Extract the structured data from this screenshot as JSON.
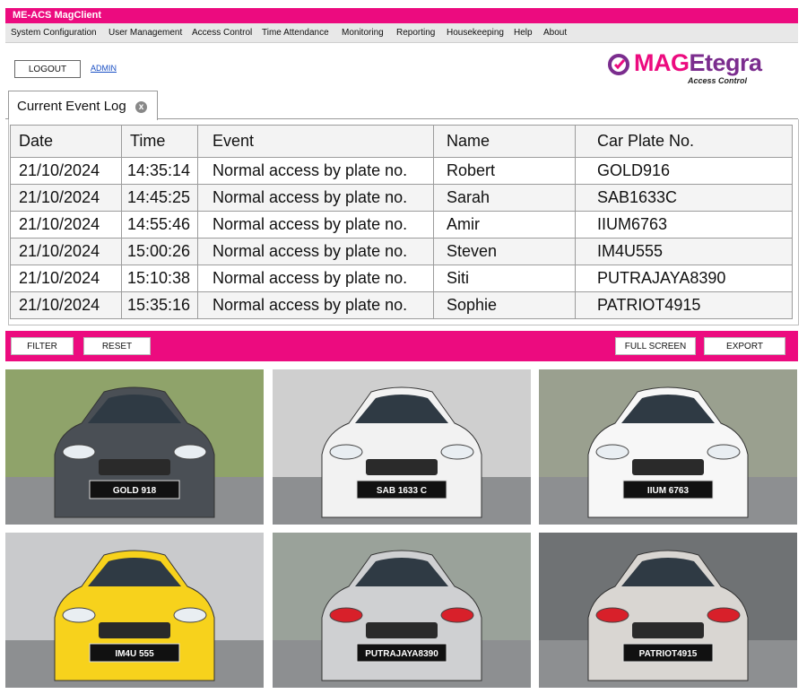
{
  "app": {
    "title": "ME-ACS MagClient"
  },
  "menu": [
    "System Configuration",
    "User Management",
    "Access Control",
    "Time Attendance",
    "Monitoring",
    "Reporting",
    "Housekeeping",
    "Help",
    "About"
  ],
  "session": {
    "logout_label": "LOGOUT",
    "user": "ADMIN"
  },
  "logo": {
    "brand_m": "MAG",
    "brand_rest": "Etegra",
    "sub": "Access Control",
    "mark_color": "#7b2d8e"
  },
  "tab": {
    "label": "Current Event Log",
    "close_glyph": "x"
  },
  "table": {
    "columns": [
      "Date",
      "Time",
      "Event",
      "Name",
      "Car Plate No."
    ],
    "rows": [
      [
        "21/10/2024",
        "14:35:14",
        "Normal access by plate no.",
        "Robert",
        "GOLD916"
      ],
      [
        "21/10/2024",
        "14:45:25",
        "Normal access by plate no.",
        "Sarah",
        "SAB1633C"
      ],
      [
        "21/10/2024",
        "14:55:46",
        "Normal access by plate no.",
        "Amir",
        "IIUM6763"
      ],
      [
        "21/10/2024",
        "15:00:26",
        "Normal access by plate no.",
        "Steven",
        "IM4U555"
      ],
      [
        "21/10/2024",
        "15:10:38",
        "Normal access by plate no.",
        "Siti",
        "PUTRAJAYA8390"
      ],
      [
        "21/10/2024",
        "15:35:16",
        "Normal access by plate no.",
        "Sophie",
        "PATRIOT4915"
      ]
    ]
  },
  "actions": {
    "filter": "FILTER",
    "reset": "RESET",
    "fullscreen": "FULL SCREEN",
    "export": "EXPORT"
  },
  "photos": [
    {
      "plate": "GOLD 918",
      "color": "#4a4f55",
      "bg": "#8fa36a",
      "view": "front"
    },
    {
      "plate": "SAB 1633 C",
      "color": "#f2f2f2",
      "bg": "#cfcfcf",
      "view": "front"
    },
    {
      "plate": "IIUM 6763",
      "color": "#f7f7f7",
      "bg": "#9aa08f",
      "view": "front"
    },
    {
      "plate": "IM4U 555",
      "color": "#f7d21c",
      "bg": "#c9cacc",
      "view": "front"
    },
    {
      "plate": "PUTRAJAYA8390",
      "color": "#cfd0d2",
      "bg": "#9aa29a",
      "view": "rear"
    },
    {
      "plate": "PATRIOT4915",
      "color": "#d9d6d2",
      "bg": "#6f7274",
      "view": "rear"
    }
  ],
  "colors": {
    "accent": "#ec0b7f",
    "brand_purple": "#7b2d8e"
  }
}
